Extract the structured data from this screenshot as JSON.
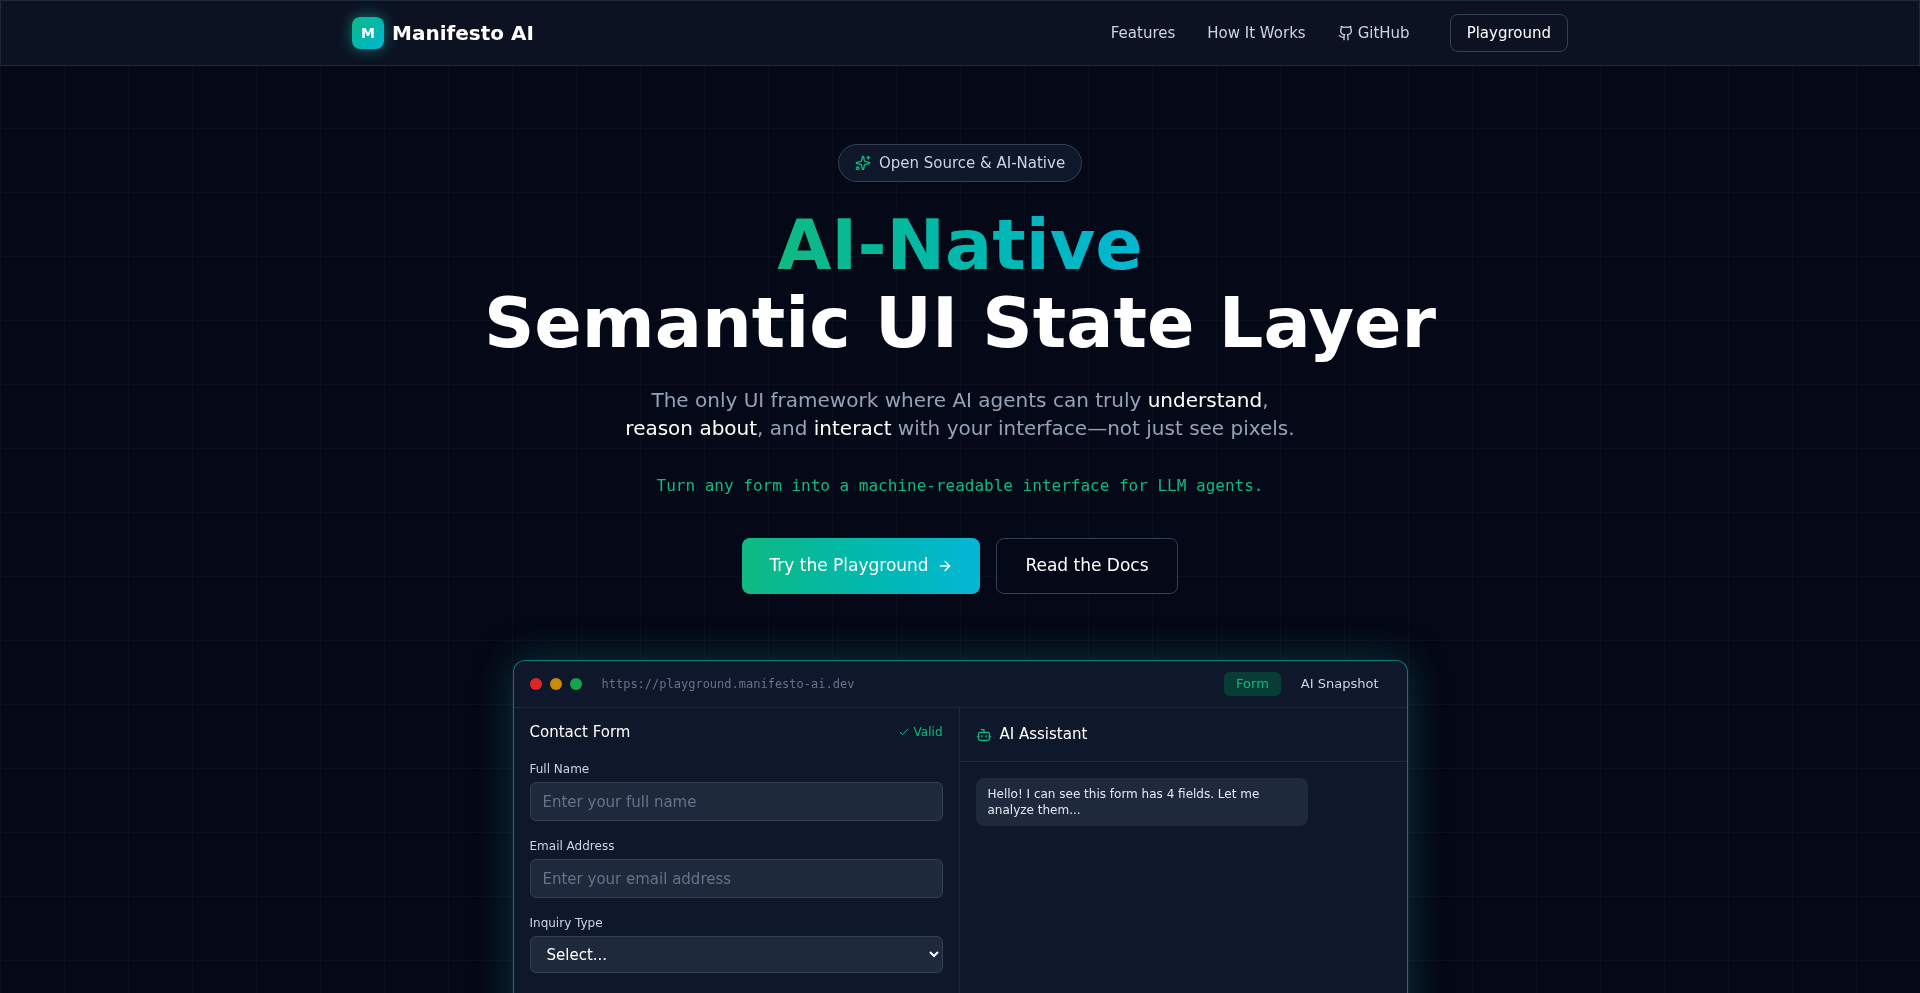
{
  "nav": {
    "logo_letter": "M",
    "brand": "Manifesto AI",
    "links": [
      {
        "label": "Features",
        "kind": "text"
      },
      {
        "label": "How It Works",
        "kind": "text"
      },
      {
        "label": "GitHub",
        "kind": "github"
      }
    ],
    "cta": "Playground"
  },
  "hero": {
    "badge": "Open Source & AI-Native",
    "title_accent": "AI-Native",
    "title": "Semantic UI State Layer",
    "subtitle": "The only UI framework where AI agents can truly **understand**,\n**reason about**, and **interact** with your interface—not just see pixels.",
    "tagline": "Turn any form into a machine-readable interface for LLM agents.",
    "primary_button": "Try the Playground",
    "secondary_button": "Read the Docs"
  },
  "demo": {
    "url": "https://playground.manifesto-ai.dev",
    "tabs": [
      {
        "label": "Form",
        "selected": true
      },
      {
        "label": "AI Snapshot",
        "selected": false
      }
    ],
    "form": {
      "title": "Contact Form",
      "status": "Valid",
      "valid": true,
      "fields": [
        {
          "label": "Full Name",
          "kind": "input",
          "placeholder": "Enter your full name"
        },
        {
          "label": "Email Address",
          "kind": "input",
          "placeholder": "Enter your email address"
        },
        {
          "label": "Inquiry Type",
          "kind": "select",
          "value": "Select..."
        }
      ]
    },
    "assistant": {
      "title": "AI Assistant",
      "messages": [
        "Hello! I can see this form has 4 fields. Let me analyze them..."
      ]
    }
  }
}
